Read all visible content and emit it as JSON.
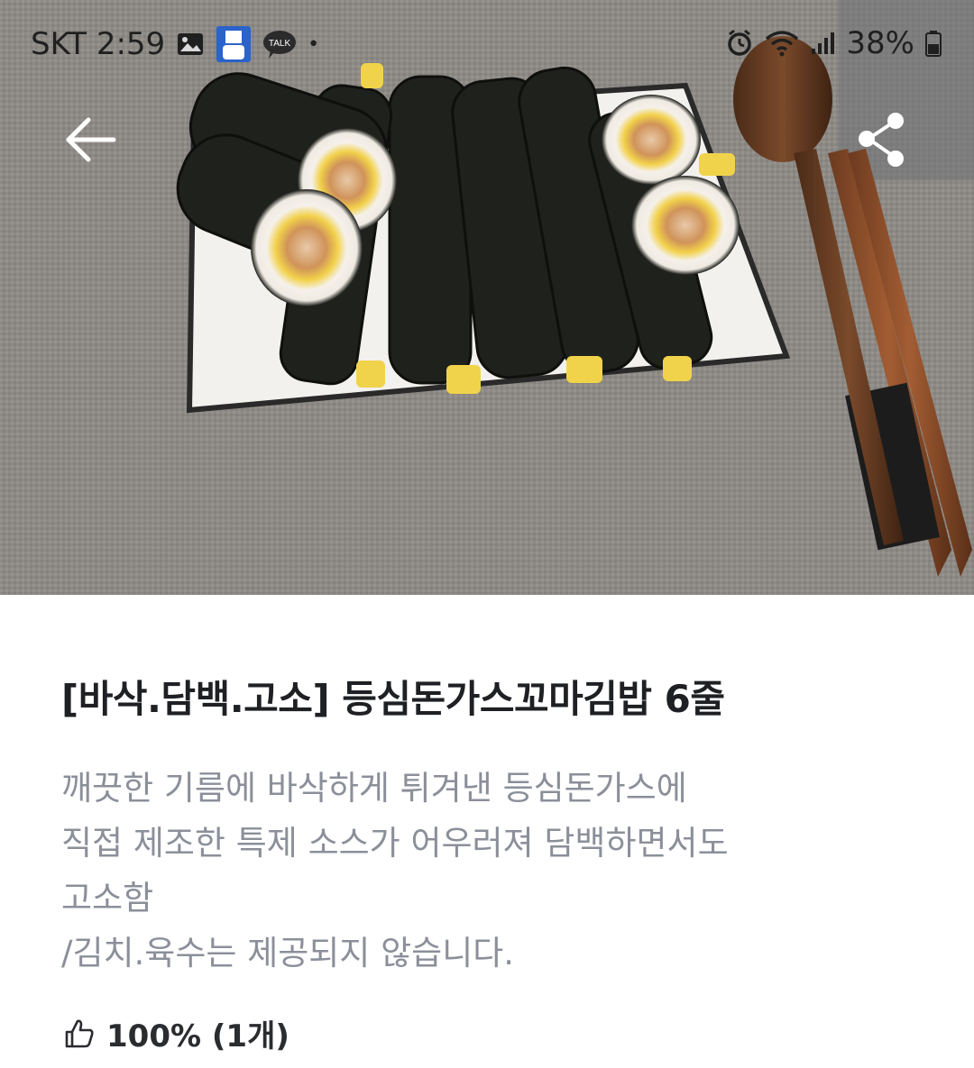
{
  "status_bar": {
    "carrier_time": "SKT 2:59",
    "talk_label": "TALK",
    "dot": "•",
    "battery": "38%",
    "icons": [
      "gallery-icon",
      "app-notification-icon",
      "kakaotalk-icon",
      "alarm-icon",
      "wifi-icon",
      "signal-icon",
      "battery-icon"
    ]
  },
  "header": {
    "back_icon": "arrow-left-icon",
    "share_icon": "share-icon"
  },
  "product": {
    "title": "[바삭.담백.고소]  등심돈가스꼬마김밥 6줄",
    "description_lines": [
      "깨끗한 기름에 바삭하게 튀겨낸 등심돈가스에",
      "직접 제조한 특제 소스가 어우러져 담백하면서도",
      "고소함",
      "/김치.육수는 제공되지 않습니다."
    ],
    "rating_text": "100% (1개)",
    "rating_icon": "thumbs-up-icon"
  },
  "colors": {
    "title": "#1f2023",
    "description": "#8b8f99",
    "rating": "#2b2c30"
  }
}
